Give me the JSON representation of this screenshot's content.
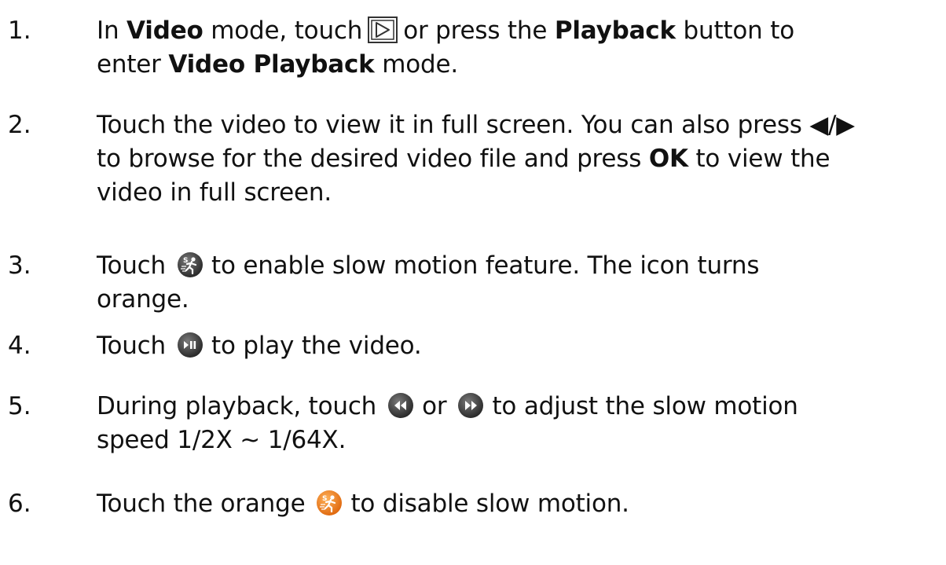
{
  "steps": [
    {
      "number": "1.",
      "p1": "In ",
      "b1": "Video",
      "p2": " mode, touch",
      "p3": "or press the ",
      "b2": "Playback",
      "p4": " button to",
      "p5": "enter ",
      "b3": "Video Playback",
      "p6": " mode."
    },
    {
      "number": "2.",
      "line1": "Touch the video to view it in full screen. You can also press",
      "arrows": "◀/▶",
      "p1": "to browse for the desired video file and press ",
      "b1": "OK",
      "p2": " to view the",
      "line3": "video in full screen."
    },
    {
      "number": "3.",
      "p1": "Touch",
      "p2": "to enable slow motion feature. The icon turns",
      "line2": "orange."
    },
    {
      "number": "4.",
      "p1": "Touch",
      "p2": "to play the video."
    },
    {
      "number": "5.",
      "p1": "During playback, touch",
      "p2": "or",
      "p3": "to adjust the slow motion",
      "line2": "speed 1/2X ~ 1/64X."
    },
    {
      "number": "6.",
      "p1": "Touch the orange",
      "p2": "to disable slow motion."
    }
  ],
  "icons": {
    "playback_mode": "playback-mode-icon",
    "slow_motion_gray": "slow-motion-icon",
    "play_pause": "play-pause-icon",
    "rewind": "rewind-icon",
    "fast_forward": "fast-forward-icon",
    "slow_motion_orange": "slow-motion-orange-icon"
  },
  "colors": {
    "text": "#111111",
    "icon_dark": "#3a3a3a",
    "icon_orange": "#f07d1a"
  }
}
